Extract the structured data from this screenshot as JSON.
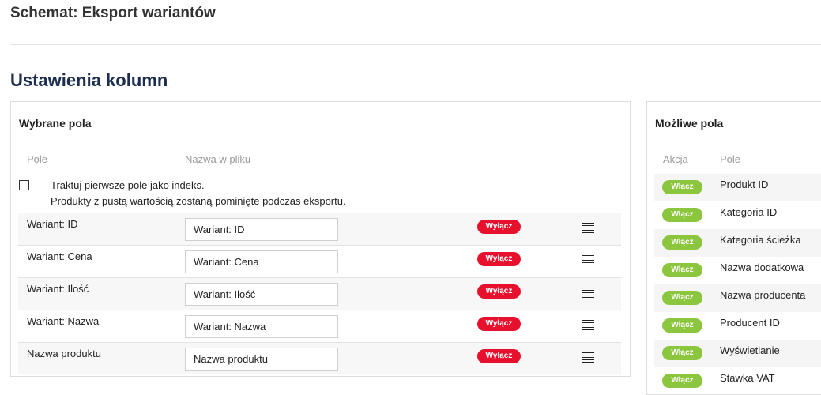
{
  "page": {
    "title": "Schemat: Eksport wariantów"
  },
  "section": {
    "title": "Ustawienia kolumn"
  },
  "selected": {
    "title": "Wybrane pola",
    "col_field": "Pole",
    "col_name": "Nazwa w pliku",
    "index_label_1": "Traktuj pierwsze pole jako indeks.",
    "index_label_2": "Produkty z pustą wartością zostaną pominięte podczas eksportu.",
    "index_checked": false,
    "disable_label": "Wyłącz",
    "rows": [
      {
        "label": "Wariant: ID",
        "value": "Wariant: ID"
      },
      {
        "label": "Wariant: Cena",
        "value": "Wariant: Cena"
      },
      {
        "label": "Wariant: Ilość",
        "value": "Wariant: Ilość"
      },
      {
        "label": "Wariant: Nazwa",
        "value": "Wariant: Nazwa"
      },
      {
        "label": "Nazwa produktu",
        "value": "Nazwa produktu"
      }
    ]
  },
  "possible": {
    "title": "Możliwe pola",
    "col_action": "Akcja",
    "col_field": "Pole",
    "enable_label": "Włącz",
    "rows": [
      {
        "label": "Produkt ID"
      },
      {
        "label": "Kategoria ID"
      },
      {
        "label": "Kategoria ścieżka"
      },
      {
        "label": "Nazwa dodatkowa"
      },
      {
        "label": "Nazwa producenta"
      },
      {
        "label": "Producent ID"
      },
      {
        "label": "Wyświetlanie"
      },
      {
        "label": "Stawka VAT"
      }
    ]
  },
  "colors": {
    "disable_button": "#e8112d",
    "enable_button": "#8cc63f",
    "section_title": "#1d2d4f"
  }
}
